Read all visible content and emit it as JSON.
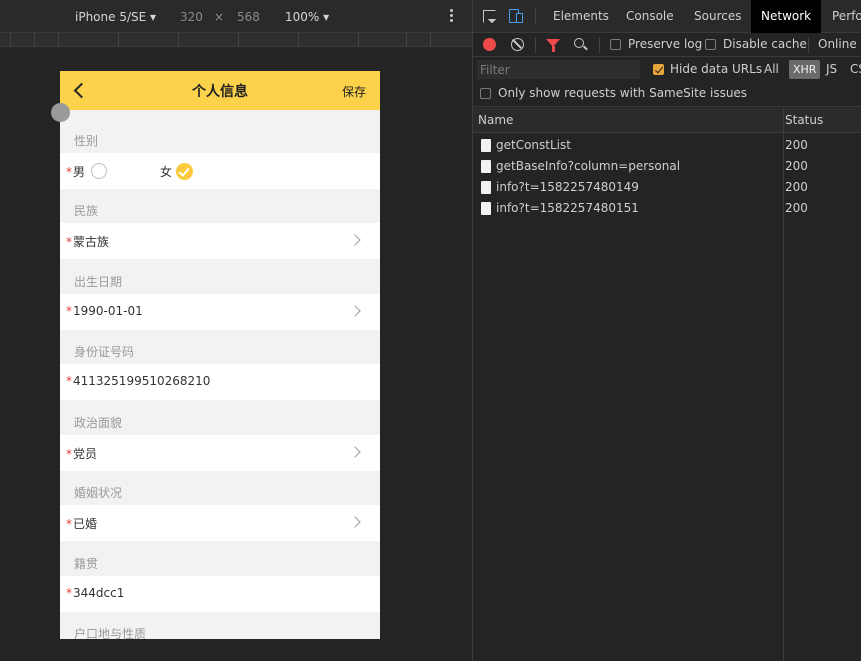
{
  "device_toolbar": {
    "device": "iPhone 5/SE",
    "width": "320",
    "times": "×",
    "height": "568",
    "zoom": "100%"
  },
  "app": {
    "title": "个人信息",
    "save": "保存",
    "required_mark": "*",
    "gender": {
      "label": "性别",
      "male": "男",
      "female": "女",
      "selected": "女"
    },
    "ethnicity": {
      "label": "民族",
      "value": "蒙古族"
    },
    "birth": {
      "label": "出生日期",
      "value": "1990-01-01"
    },
    "id_number": {
      "label": "身份证号码",
      "value": "411325199510268210"
    },
    "political": {
      "label": "政治面貌",
      "value": "党员"
    },
    "marital": {
      "label": "婚姻状况",
      "value": "已婚"
    },
    "native_place": {
      "label": "籍贯",
      "value": "344dcc1"
    },
    "hukou": {
      "label": "户口地与性质"
    }
  },
  "devtools": {
    "tabs": [
      "Elements",
      "Console",
      "Sources",
      "Network",
      "Perfor"
    ],
    "active_tab": "Network",
    "preserve_log": "Preserve log",
    "disable_cache": "Disable cache",
    "throttle": "Online",
    "filter_placeholder": "Filter",
    "hide_data_urls": "Hide data URLs",
    "types": {
      "all": "All",
      "xhr": "XHR",
      "js": "JS",
      "css": "CS"
    },
    "samesite": "Only show requests with SameSite issues",
    "columns": {
      "name": "Name",
      "status": "Status"
    },
    "requests": [
      {
        "name": "getConstList",
        "status": "200"
      },
      {
        "name": "getBaseInfo?column=personal",
        "status": "200"
      },
      {
        "name": "info?t=1582257480149",
        "status": "200"
      },
      {
        "name": "info?t=1582257480151",
        "status": "200"
      }
    ]
  },
  "colors": {
    "accent": "#fbd24a",
    "check": "#fbc93b",
    "record": "#ef4a4a",
    "required": "#e23c3c"
  }
}
